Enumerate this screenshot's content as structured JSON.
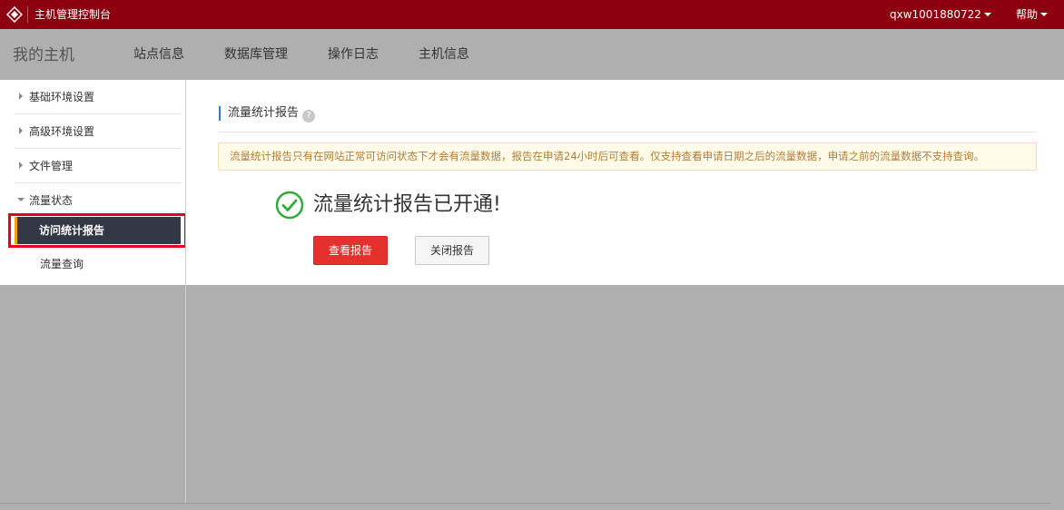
{
  "topbar": {
    "app_title": "主机管理控制台",
    "user": "qxw1001880722",
    "help": "帮助",
    "brand_color": "#8c0010"
  },
  "nav": {
    "brand": "我的主机",
    "items": [
      {
        "label": "站点信息"
      },
      {
        "label": "数据库管理"
      },
      {
        "label": "操作日志"
      },
      {
        "label": "主机信息"
      }
    ]
  },
  "sidebar": {
    "groups": [
      {
        "label": "基础环境设置",
        "expanded": false
      },
      {
        "label": "高级环境设置",
        "expanded": false
      },
      {
        "label": "文件管理",
        "expanded": false
      },
      {
        "label": "流量状态",
        "expanded": true
      }
    ],
    "sub_items": [
      {
        "label": "访问统计报告",
        "active": true
      },
      {
        "label": "流量查询",
        "active": false
      }
    ]
  },
  "main": {
    "section_title": "流量统计报告",
    "help_icon": "question-icon",
    "notice": "流量统计报告只有在网站正常可访问状态下才会有流量数据，报告在申请24小时后可查看。仅支持查看申请日期之后的流量数据，申请之前的流量数据不支持查询。",
    "success_message": "流量统计报告已开通!",
    "view_button": "查看报告",
    "close_button": "关闭报告",
    "accent_color": "#e5312d",
    "success_color": "#2eab3e"
  }
}
